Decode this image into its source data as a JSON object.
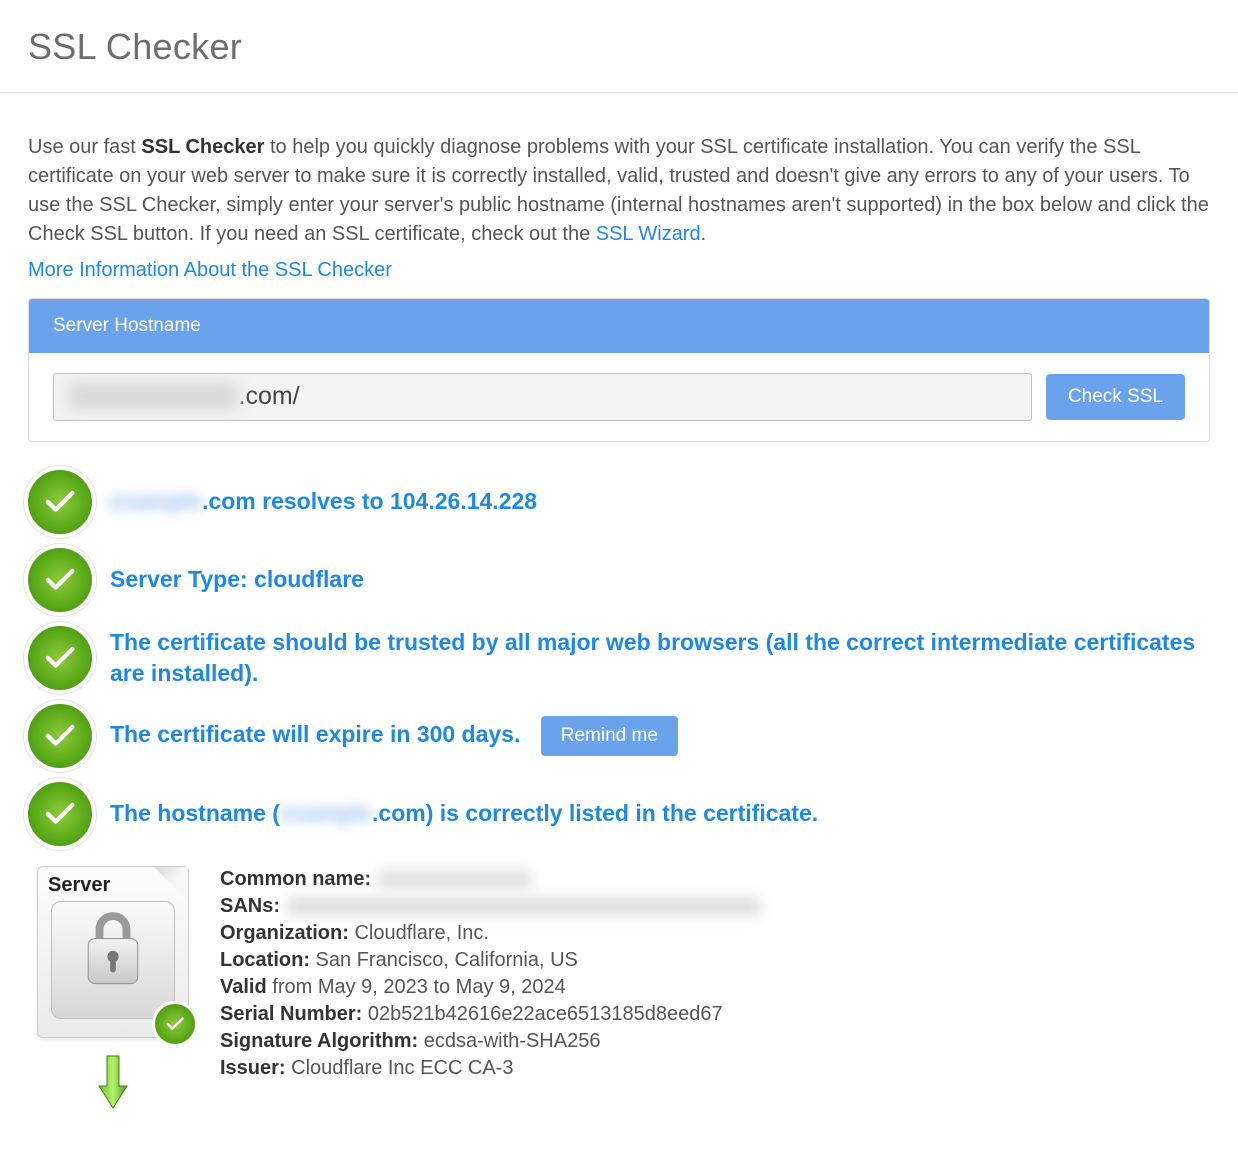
{
  "header": {
    "title": "SSL Checker"
  },
  "intro": {
    "before_strong": "Use our fast ",
    "strong": "SSL Checker",
    "after_strong": " to help you quickly diagnose problems with your SSL certificate installation. You can verify the SSL certificate on your web server to make sure it is correctly installed, valid, trusted and doesn't give any errors to any of your users. To use the SSL Checker, simply enter your server's public hostname (internal hostnames aren't supported) in the box below and click the Check SSL button. If you need an SSL certificate, check out the ",
    "link_text": "SSL Wizard",
    "period": "."
  },
  "more_info_link": "More Information About the SSL Checker",
  "form": {
    "label": "Server Hostname",
    "input_value": "",
    "input_display_suffix": ".com/",
    "check_button": "Check SSL"
  },
  "results": [
    {
      "id": "resolves",
      "prefix_blurred": "example",
      "text_before": "",
      "text_after": ".com resolves to 104.26.14.228"
    },
    {
      "id": "server-type",
      "text": "Server Type: cloudflare"
    },
    {
      "id": "trusted",
      "text": "The certificate should be trusted by all major web browsers (all the correct intermediate certificates are installed)."
    },
    {
      "id": "expire",
      "text": "The certificate will expire in 300 days. ",
      "button": "Remind me"
    },
    {
      "id": "hostname",
      "text_before": "The hostname (",
      "blurred_mid": "example",
      "text_after": ".com) is correctly listed in the certificate."
    }
  ],
  "cert": {
    "server_label": "Server",
    "common_name_label": "Common name:",
    "sans_label": "SANs:",
    "organization_label": "Organization:",
    "organization": " Cloudflare, Inc.",
    "location_label": "Location:",
    "location": " San Francisco, California, US",
    "valid_label": "Valid",
    "valid": " from May 9, 2023 to May 9, 2024",
    "serial_label": "Serial Number:",
    "serial": " 02b521b42616e22ace6513185d8eed67",
    "sig_label": "Signature Algorithm:",
    "sig": " ecdsa-with-SHA256",
    "issuer_label": "Issuer:",
    "issuer": " Cloudflare Inc ECC CA-3"
  }
}
